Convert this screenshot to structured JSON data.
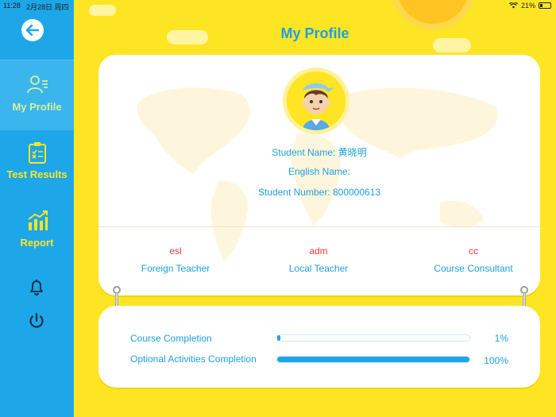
{
  "status_bar": {
    "time": "11:28",
    "date": "2月28日 周四",
    "battery_percent": "21%"
  },
  "sidebar": {
    "items": [
      {
        "label": "My Profile",
        "icon": "profile-icon",
        "active": true
      },
      {
        "label": "Test Results",
        "icon": "clipboard-icon",
        "active": false
      },
      {
        "label": "Report",
        "icon": "chart-icon",
        "active": false
      }
    ],
    "bottom_icons": [
      "bell-icon",
      "power-icon"
    ]
  },
  "page": {
    "title": "My Profile"
  },
  "profile": {
    "student_name": "Student Name: 黄晓明",
    "english_name": "English Name:",
    "student_number": "Student Number: 800000613"
  },
  "teachers": [
    {
      "code": "esl",
      "role": "Foreign Teacher"
    },
    {
      "code": "adm",
      "role": "Local Teacher"
    },
    {
      "code": "cc",
      "role": "Course Consultant"
    }
  ],
  "progress": [
    {
      "label": "Course Completion",
      "value_text": "1%",
      "fraction": 0.01
    },
    {
      "label": "Optional Activities Completion",
      "value_text": "100%",
      "fraction": 1.0
    }
  ],
  "colors": {
    "background_yellow": "#fde523",
    "sidebar_blue": "#1da7e9",
    "accent_text_blue": "#1da0df",
    "teacher_code_red": "#e73b3b",
    "active_label_green": "#d7f099"
  }
}
